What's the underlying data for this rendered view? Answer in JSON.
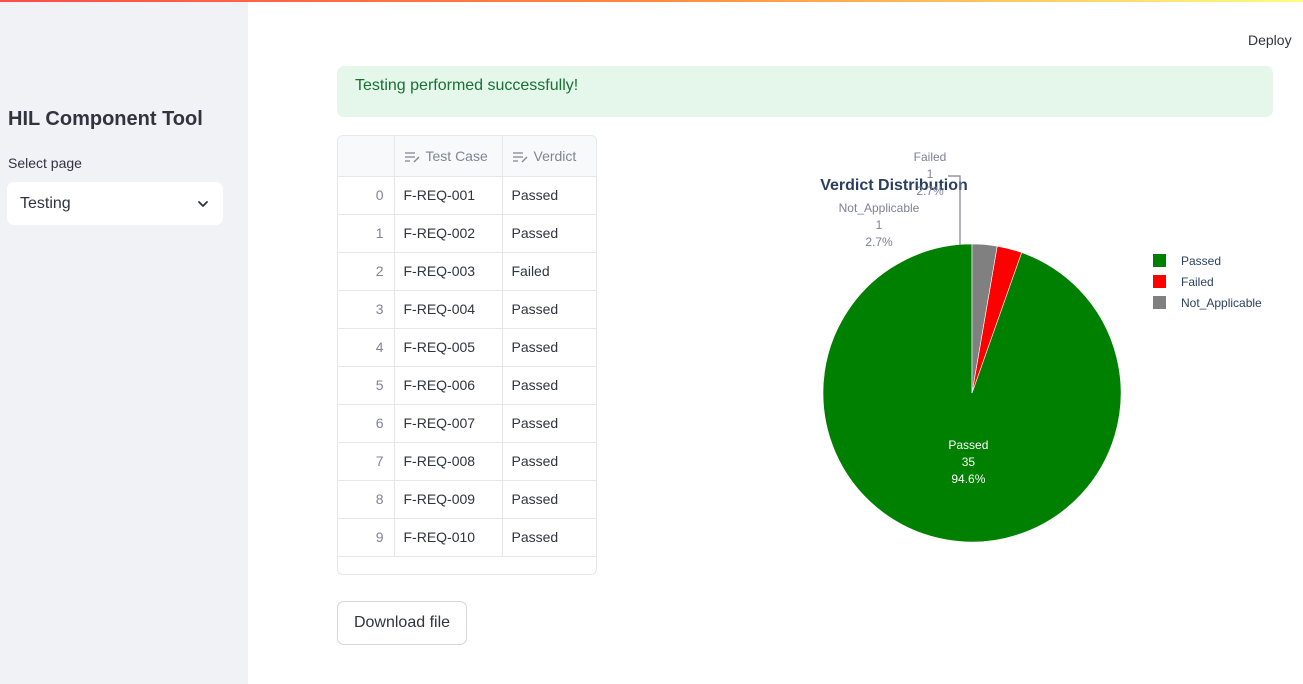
{
  "header": {
    "deploy_label": "Deploy"
  },
  "sidebar": {
    "title": "HIL Component Tool",
    "select_label": "Select page",
    "select_value": "Testing"
  },
  "alert": {
    "message": "Testing performed successfully!"
  },
  "table": {
    "columns": [
      "Test Case",
      "Verdict"
    ],
    "rows": [
      {
        "index": "0",
        "test_case": "F-REQ-001",
        "verdict": "Passed"
      },
      {
        "index": "1",
        "test_case": "F-REQ-002",
        "verdict": "Passed"
      },
      {
        "index": "2",
        "test_case": "F-REQ-003",
        "verdict": "Failed"
      },
      {
        "index": "3",
        "test_case": "F-REQ-004",
        "verdict": "Passed"
      },
      {
        "index": "4",
        "test_case": "F-REQ-005",
        "verdict": "Passed"
      },
      {
        "index": "5",
        "test_case": "F-REQ-006",
        "verdict": "Passed"
      },
      {
        "index": "6",
        "test_case": "F-REQ-007",
        "verdict": "Passed"
      },
      {
        "index": "7",
        "test_case": "F-REQ-008",
        "verdict": "Passed"
      },
      {
        "index": "8",
        "test_case": "F-REQ-009",
        "verdict": "Passed"
      },
      {
        "index": "9",
        "test_case": "F-REQ-010",
        "verdict": "Passed"
      }
    ]
  },
  "download_label": "Download file",
  "chart_data": {
    "type": "pie",
    "title": "Verdict Distribution",
    "categories": [
      "Passed",
      "Failed",
      "Not_Applicable"
    ],
    "values": [
      35,
      1,
      1
    ],
    "percent_labels": [
      "94.6%",
      "2.7%",
      "2.7%"
    ],
    "colors": [
      "#008000",
      "#ff0000",
      "#808080"
    ],
    "legend_position": "right"
  }
}
